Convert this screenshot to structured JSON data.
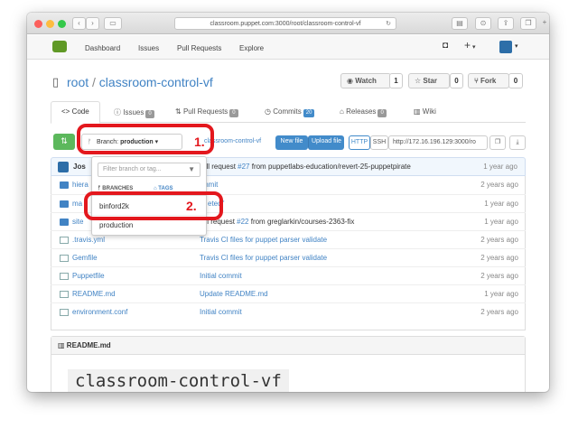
{
  "browser": {
    "url": "classroom.puppet.com:3000/root/classroom-control-vf"
  },
  "header": {
    "nav": [
      "Dashboard",
      "Issues",
      "Pull Requests",
      "Explore"
    ],
    "plus": "+"
  },
  "repo": {
    "owner": "root",
    "sep": "/",
    "name": "classroom-control-vf",
    "watch": {
      "label": "Watch",
      "count": "1"
    },
    "star": {
      "label": "Star",
      "count": "0"
    },
    "fork": {
      "label": "Fork",
      "count": "0"
    }
  },
  "tabs": [
    {
      "label": "Code"
    },
    {
      "label": "Issues",
      "count": "0"
    },
    {
      "label": "Pull Requests",
      "count": "0"
    },
    {
      "label": "Commits",
      "count": "20"
    },
    {
      "label": "Releases",
      "count": "0"
    },
    {
      "label": "Wiki"
    }
  ],
  "toolbar": {
    "branch_prefix": "Branch:",
    "branch": "production",
    "path": "classroom-control-vf",
    "new_file": "New file",
    "upload_file": "Upload file",
    "http": "HTTP",
    "ssh": "SSH",
    "clone_url": "http://172.16.196.129:3000/ro"
  },
  "dropdown": {
    "placeholder": "Filter branch or tag...",
    "tab_branches": "BRANCHES",
    "tab_tags": "TAGS",
    "items": [
      "binford2k",
      "production"
    ]
  },
  "commit": {
    "author": "Jos",
    "message_prefix": "ull request ",
    "pr": "#27",
    "message_suffix": " from puppetlabs-education/revert-25-puppetpirate",
    "age": "1 year ago"
  },
  "files": [
    {
      "name": "hiera",
      "message": "mmit",
      "age": "2 years ago",
      "type": "folder"
    },
    {
      "name": "ma",
      "message": "eted\"",
      "age": "1 year ago",
      "type": "folder"
    },
    {
      "name": "site",
      "message_prefix": "ull request ",
      "pr": "#22",
      "message_suffix": " from greglarkin/courses-2363-fix",
      "age": "1 year ago",
      "type": "folder"
    },
    {
      "name": ".travis.yml",
      "message": "Travis CI files for puppet parser validate",
      "age": "2 years ago",
      "type": "file"
    },
    {
      "name": "Gemfile",
      "message": "Travis CI files for puppet parser validate",
      "age": "2 years ago",
      "type": "file"
    },
    {
      "name": "Puppetfile",
      "message": "Initial commit",
      "age": "2 years ago",
      "type": "file"
    },
    {
      "name": "README.md",
      "message": "Update README.md",
      "age": "1 year ago",
      "type": "file"
    },
    {
      "name": "environment.conf",
      "message": "Initial commit",
      "age": "2 years ago",
      "type": "file"
    }
  ],
  "readme": {
    "title": "README.md",
    "heading": "classroom-control-vf"
  },
  "annotations": {
    "one": "1.",
    "two": "2."
  },
  "colors": {
    "green": "#5cb85c",
    "blue": "#428bca",
    "red": "#e3171d",
    "link": "#4183c4"
  }
}
